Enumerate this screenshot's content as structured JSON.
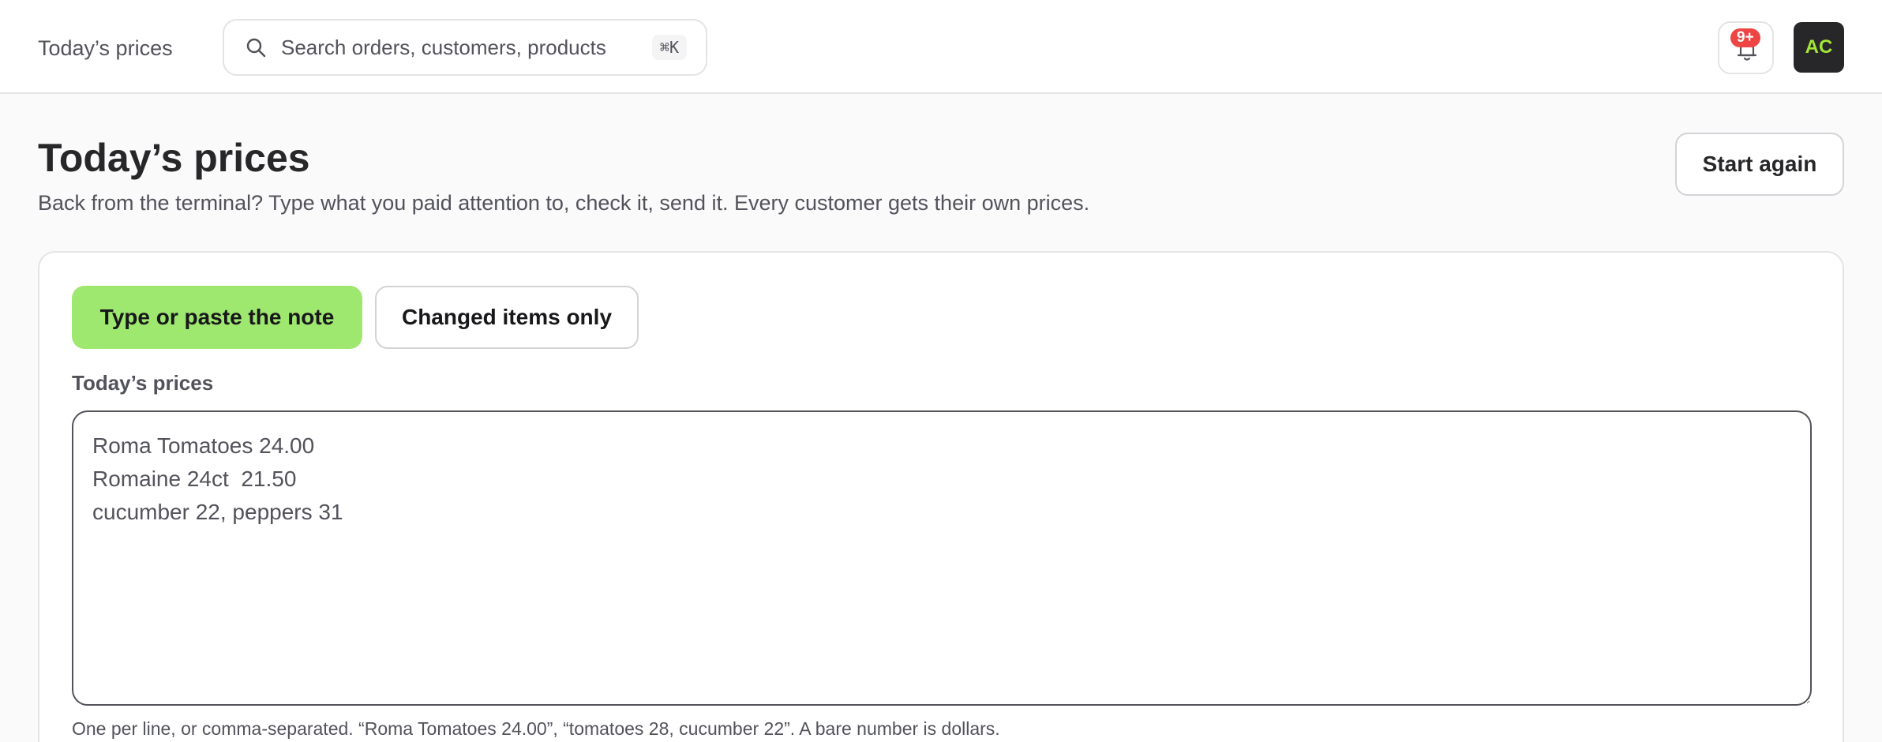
{
  "header": {
    "title": "Today’s prices",
    "search_placeholder": "Search orders, customers, products",
    "search_shortcut": "⌘K",
    "notification_count": "9+",
    "avatar_initials": "AC"
  },
  "page": {
    "title": "Today’s prices",
    "subtitle": "Back from the terminal? Type what you paid attention to, check it, send it. Every customer gets their own prices.",
    "start_again_label": "Start again"
  },
  "editor": {
    "tabs": [
      {
        "label": "Type or paste the note",
        "active": true
      },
      {
        "label": "Changed items only",
        "active": false
      }
    ],
    "field_label": "Today’s prices",
    "value": "Roma Tomatoes 24.00\nRomaine 24ct  21.50\ncucumber 22, peppers 31",
    "hint": "One per line, or comma-separated. “Roma Tomatoes 24.00”, “tomatoes 28, cucumber 22”. A bare number is dollars."
  },
  "icons": [
    "search-icon",
    "bell-icon"
  ],
  "colors": {
    "accent": "#9fe870",
    "badge": "#ef4444",
    "avatar_bg": "#27272a",
    "avatar_text": "#a3e635"
  }
}
